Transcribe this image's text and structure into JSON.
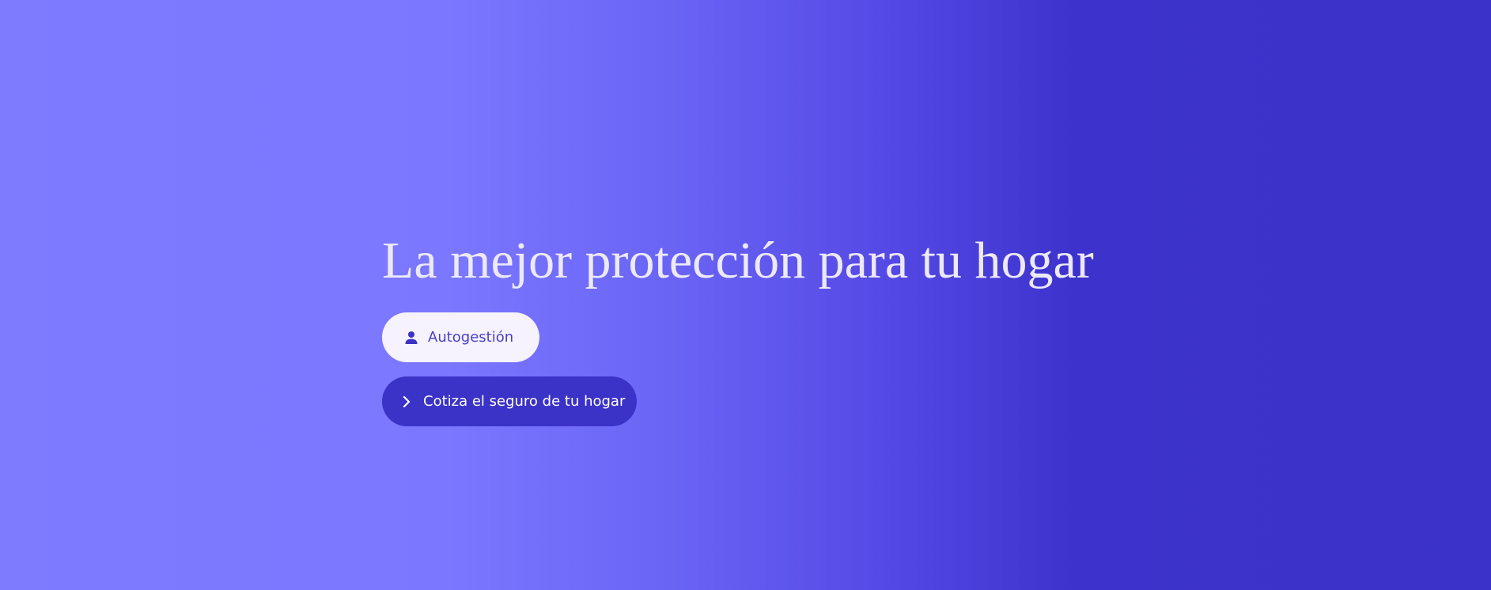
{
  "hero": {
    "title": "La mejor protección para tu hogar",
    "colors": {
      "gradient_start": "#7f7bff",
      "gradient_end": "#3b32c9",
      "title_color": "#ece9fb",
      "light_button_bg": "#f6f3fe",
      "light_button_text": "#4a3fc7",
      "dark_button_bg": "#3b32c7",
      "dark_button_text": "#ffffff"
    }
  },
  "buttons": {
    "autogestion": {
      "label": "Autogestión",
      "icon": "user-icon"
    },
    "cotiza": {
      "label": "Cotiza el seguro de tu hogar",
      "icon": "chevron-right-icon"
    }
  }
}
